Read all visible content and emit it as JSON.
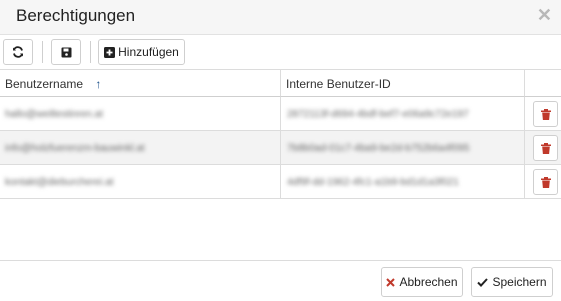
{
  "dialog": {
    "title": "Berechtigungen",
    "close_glyph": "✕"
  },
  "toolbar": {
    "add_label": "Hinzufügen",
    "icons": [
      "refresh-icon",
      "save-icon",
      "plus-square-icon"
    ]
  },
  "table": {
    "columns": [
      "Benutzername",
      "Interne Benutzer-ID"
    ],
    "sort_indicator": "↑",
    "rows": [
      {
        "username": "hallo@weiltestinren.at",
        "user_id": "2872113f-d694-4bdf-bef7-e06a9c72e197"
      },
      {
        "username": "info@holzfuerenzm-bauwinkl.at",
        "user_id": "7b8b0ad-01c7-4ba9-be2d-b752b6a4f095"
      },
      {
        "username": "kontakt@dieburcherei.at",
        "user_id": "4df9f-dd-1962-4fc1-a1b9-bd1d1a3f021"
      }
    ]
  },
  "footer": {
    "cancel_label": "Abbrechen",
    "save_label": "Speichern"
  },
  "colors": {
    "danger": "#c0392b",
    "text": "#222222",
    "border": "#cfcfcf"
  }
}
